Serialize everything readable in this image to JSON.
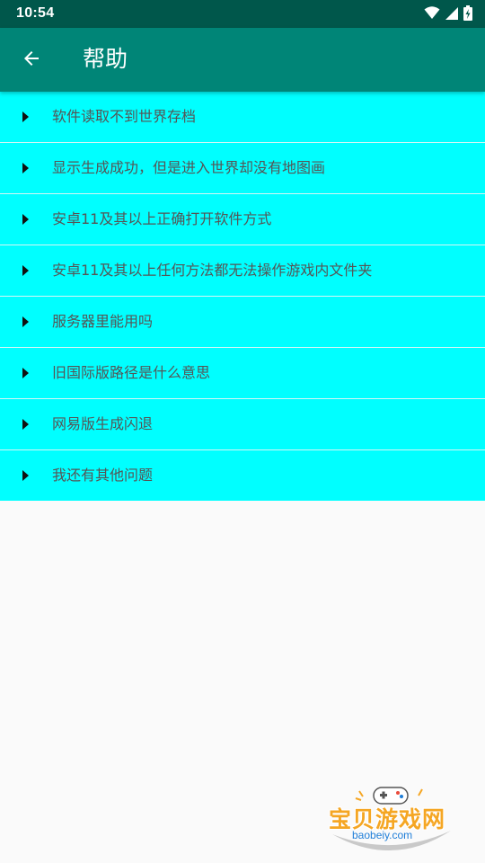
{
  "status_bar": {
    "time": "10:54",
    "icons": [
      "wifi-icon",
      "signal-icon",
      "battery-charging-icon"
    ]
  },
  "app_bar": {
    "back_icon": "arrow-left-icon",
    "title": "帮助"
  },
  "faq": {
    "items": [
      {
        "label": "软件读取不到世界存档"
      },
      {
        "label": "显示生成成功，但是进入世界却没有地图画"
      },
      {
        "label": "安卓11及其以上正确打开软件方式"
      },
      {
        "label": "安卓11及其以上任何方法都无法操作游戏内文件夹"
      },
      {
        "label": "服务器里能用吗"
      },
      {
        "label": "旧国际版路径是什么意思"
      },
      {
        "label": "网易版生成闪退"
      },
      {
        "label": "我还有其他问题"
      }
    ]
  },
  "watermark": {
    "text": "宝贝游戏网",
    "url": "baobeiy.com"
  },
  "colors": {
    "status_bar": "#00574b",
    "app_bar": "#008577",
    "list_item_bg": "#00ffff",
    "page_bg": "#fafafa"
  }
}
